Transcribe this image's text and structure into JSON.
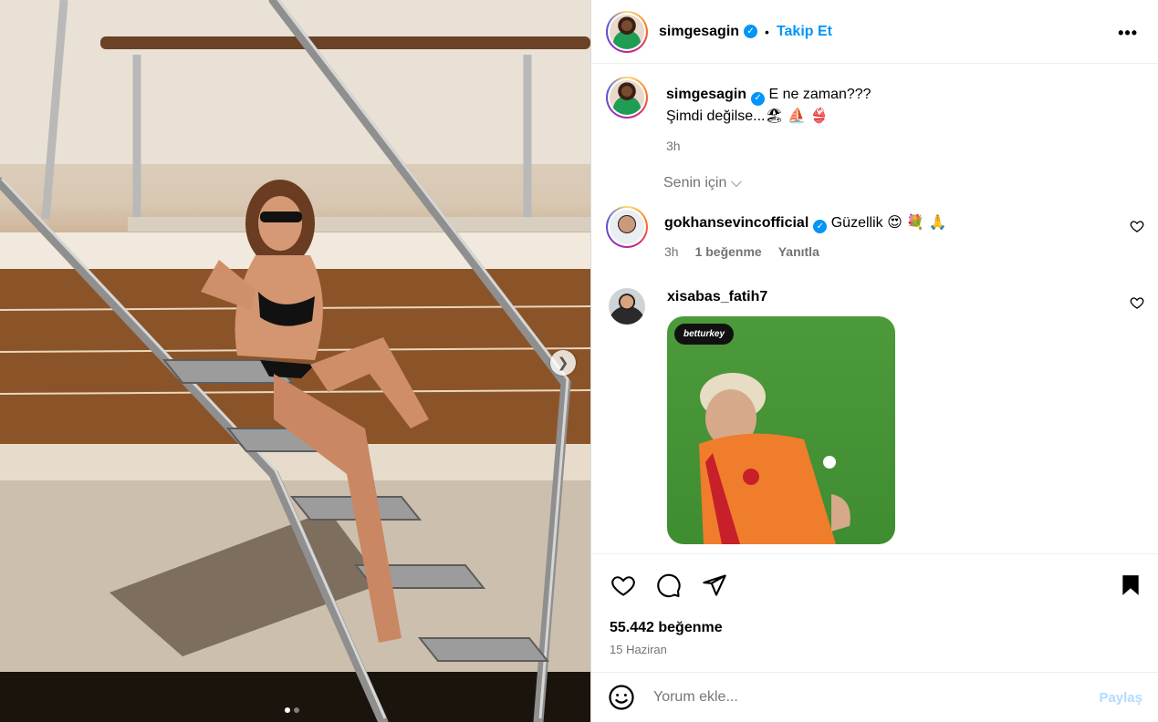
{
  "post": {
    "username": "simgesagin",
    "follow_label": "Takip Et",
    "separator": "•",
    "more_label": "•••",
    "caption_line1": "E ne zaman???",
    "caption_line2": "Şimdi değilse...🏖 ⛵ 👙",
    "caption_time": "3h",
    "likes": "55.442 beğenme",
    "date": "15 Haziran",
    "carousel": {
      "current": 1,
      "total": 2
    }
  },
  "comments_header": {
    "label": "Senin için",
    "chevron": "⌵"
  },
  "comments": [
    {
      "username": "gokhansevincofficial",
      "text": "Güzellik 😍 💐 🙏",
      "time": "3h",
      "likes_label": "1 beğenme",
      "reply_label": "Yanıtla"
    },
    {
      "username": "xisabas_fatih7",
      "gif_logo": "betturkey"
    }
  ],
  "composer": {
    "placeholder": "Yorum ekle...",
    "share_label": "Paylaş"
  },
  "icons": {
    "verified": "verified-badge-icon",
    "like": "heart-icon",
    "comment": "comment-icon",
    "share": "send-icon",
    "save": "bookmark-icon",
    "emoji": "smiley-icon",
    "next": "chevron-right-icon"
  },
  "colors": {
    "accent": "#0095f6",
    "muted": "#737373",
    "share_disabled": "#b3dbff"
  }
}
